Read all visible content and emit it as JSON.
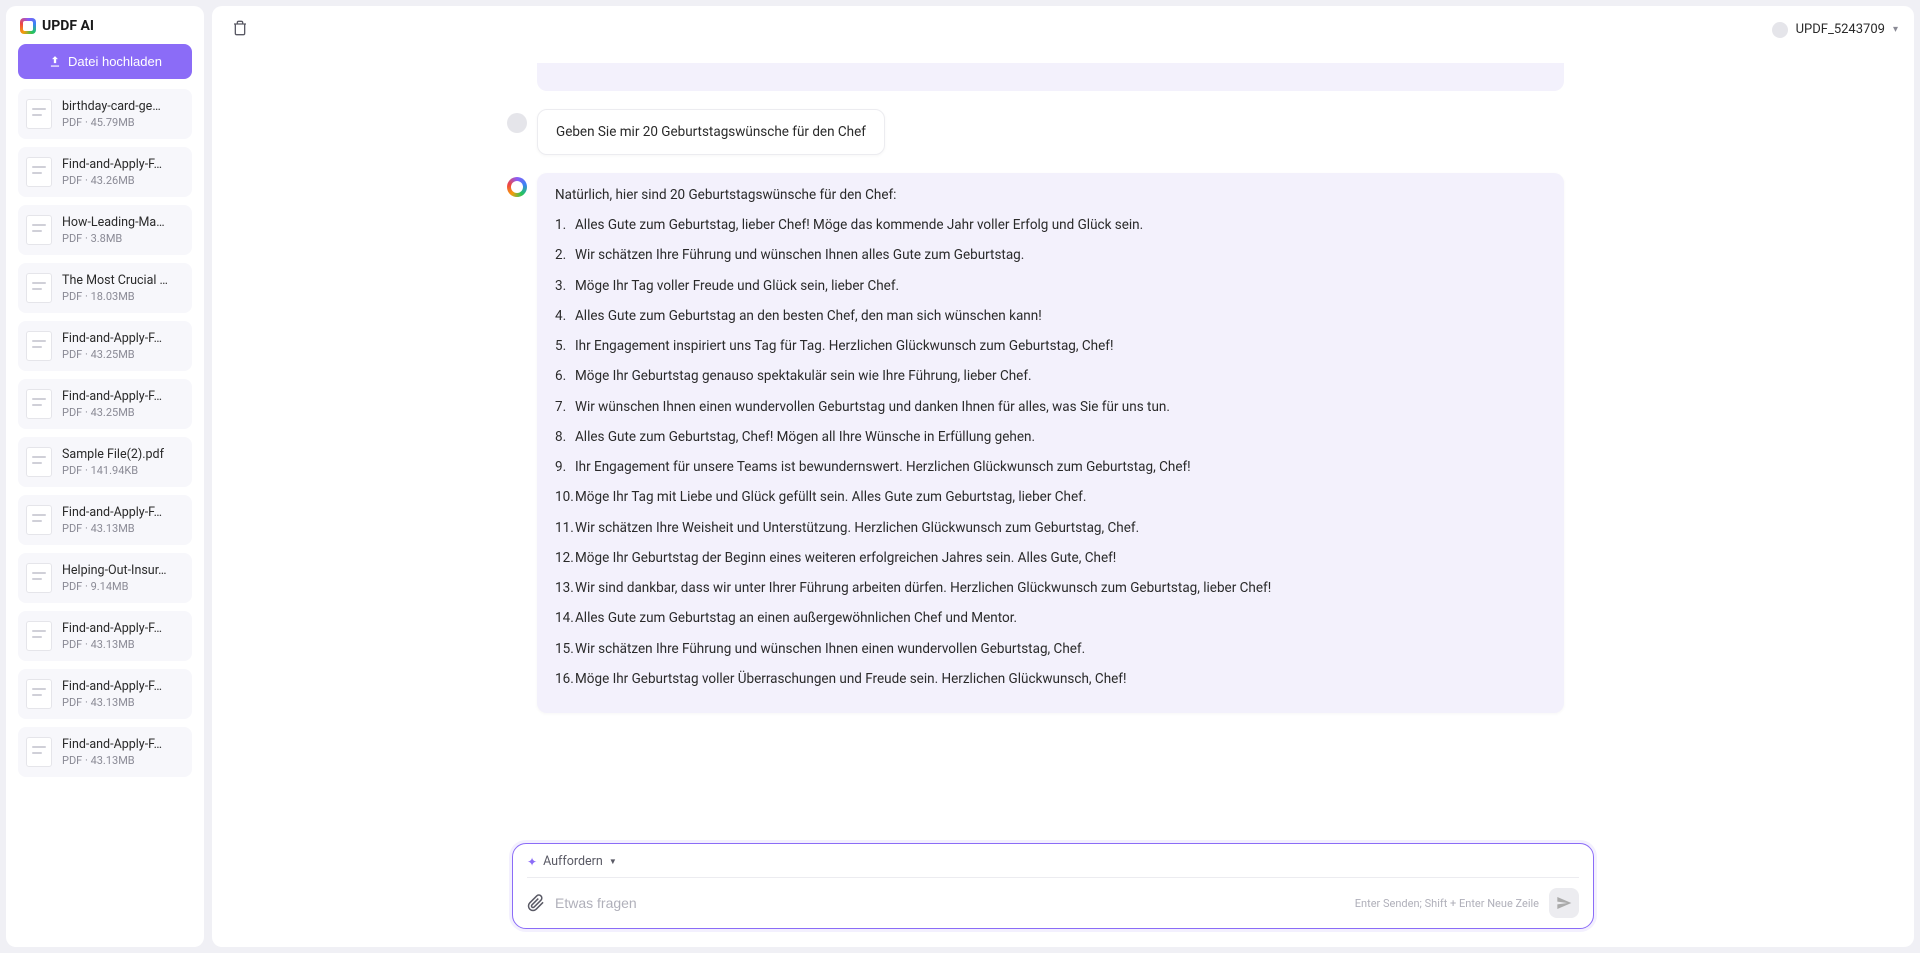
{
  "app": {
    "title": "UPDF AI"
  },
  "upload_label": "Datei hochladen",
  "files": [
    {
      "name": "birthday-card-ge…",
      "meta": "PDF · 45.79MB"
    },
    {
      "name": "Find-and-Apply-F…",
      "meta": "PDF · 43.26MB"
    },
    {
      "name": "How-Leading-Ma…",
      "meta": "PDF · 3.8MB"
    },
    {
      "name": "The Most Crucial …",
      "meta": "PDF · 18.03MB"
    },
    {
      "name": "Find-and-Apply-F…",
      "meta": "PDF · 43.25MB"
    },
    {
      "name": "Find-and-Apply-F…",
      "meta": "PDF · 43.25MB"
    },
    {
      "name": "Sample File(2).pdf",
      "meta": "PDF · 141.94KB"
    },
    {
      "name": "Find-and-Apply-F…",
      "meta": "PDF · 43.13MB"
    },
    {
      "name": "Helping-Out-Insur…",
      "meta": "PDF · 9.14MB"
    },
    {
      "name": "Find-and-Apply-F…",
      "meta": "PDF · 43.13MB"
    },
    {
      "name": "Find-and-Apply-F…",
      "meta": "PDF · 43.13MB"
    },
    {
      "name": "Find-and-Apply-F…",
      "meta": "PDF · 43.13MB"
    }
  ],
  "user": {
    "name": "UPDF_5243709"
  },
  "chat": {
    "user_msg": "Geben Sie mir 20 Geburtstagswünsche für den Chef",
    "bot_intro": "Natürlich, hier sind 20 Geburtstagswünsche für den Chef:",
    "wishes": [
      "Alles Gute zum Geburtstag, lieber Chef! Möge das kommende Jahr voller Erfolg und Glück sein.",
      "Wir schätzen Ihre Führung und wünschen Ihnen alles Gute zum Geburtstag.",
      "Möge Ihr Tag voller Freude und Glück sein, lieber Chef.",
      "Alles Gute zum Geburtstag an den besten Chef, den man sich wünschen kann!",
      "Ihr Engagement inspiriert uns Tag für Tag. Herzlichen Glückwunsch zum Geburtstag, Chef!",
      "Möge Ihr Geburtstag genauso spektakulär sein wie Ihre Führung, lieber Chef.",
      "Wir wünschen Ihnen einen wundervollen Geburtstag und danken Ihnen für alles, was Sie für uns tun.",
      "Alles Gute zum Geburtstag, Chef! Mögen all Ihre Wünsche in Erfüllung gehen.",
      "Ihr Engagement für unsere Teams ist bewundernswert. Herzlichen Glückwunsch zum Geburtstag, Chef!",
      "Möge Ihr Tag mit Liebe und Glück gefüllt sein. Alles Gute zum Geburtstag, lieber Chef.",
      "Wir schätzen Ihre Weisheit und Unterstützung. Herzlichen Glückwunsch zum Geburtstag, Chef.",
      "Möge Ihr Geburtstag der Beginn eines weiteren erfolgreichen Jahres sein. Alles Gute, Chef!",
      "Wir sind dankbar, dass wir unter Ihrer Führung arbeiten dürfen. Herzlichen Glückwunsch zum Geburtstag, lieber Chef!",
      "Alles Gute zum Geburtstag an einen außergewöhnlichen Chef und Mentor.",
      "Wir schätzen Ihre Führung und wünschen Ihnen einen wundervollen Geburtstag, Chef.",
      "Möge Ihr Geburtstag voller Überraschungen und Freude sein. Herzlichen Glückwunsch, Chef!"
    ]
  },
  "input": {
    "prompt_label": "Auffordern",
    "placeholder": "Etwas fragen",
    "hint": "Enter Senden; Shift + Enter Neue Zeile"
  }
}
